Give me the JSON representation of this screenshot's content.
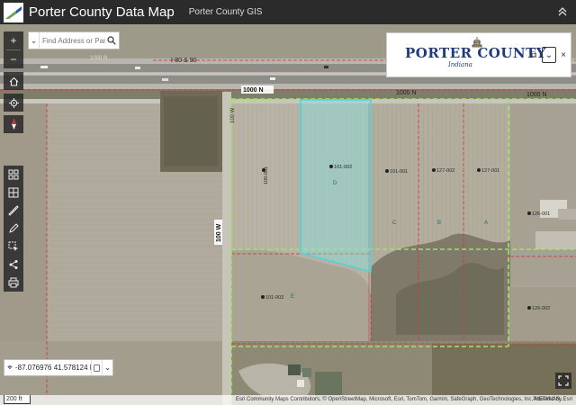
{
  "header": {
    "title": "Porter County Data Map",
    "subtitle": "Porter County GIS",
    "menu_icon": "chevron-up-icon"
  },
  "search": {
    "placeholder": "Find Address or Parc..."
  },
  "toolbar_top": [
    "zoom-in-icon",
    "zoom-out-icon",
    "home-icon",
    "locate-icon",
    "compass-icon"
  ],
  "zoom": {
    "in": "+",
    "out": "−"
  },
  "toolbar_tools": [
    "basemap-icon",
    "layers-icon",
    "measure-icon",
    "draw-icon",
    "select-icon",
    "share-icon",
    "print-icon"
  ],
  "brand": {
    "name": "PORTER COUNTY",
    "tagline": "Indiana",
    "minimize_label": "⧉",
    "dropdown_label": "⌄",
    "close_label": "×"
  },
  "coordinates": {
    "value": "-87.076976 41.578124 Degr..."
  },
  "scale": {
    "label": "200 ft"
  },
  "attribution": "Esri Community Maps Contributors, © OpenStreetMap, Microsoft, Esri, TomTom, Garmin, SafeGraph, GeoTechnologies, Inc, METI/NAS...",
  "powered_by": "Powered by Esri",
  "map_labels": {
    "highway": "I-80 & 90",
    "road_north_1": "1000 N",
    "road_north_2": "1000 N",
    "road_north_3": "1000 N",
    "road_north_4": "1000 N",
    "road_west": "100 W",
    "road_west_2": "100 W",
    "parcels": [
      "101-002",
      "101-001",
      "127-002",
      "127-001",
      "100-001",
      "101-003",
      "126-001",
      "126-002"
    ],
    "parcel_letters": [
      "D",
      "C",
      "B",
      "A",
      "E"
    ]
  },
  "colors": {
    "selection_fill": "#7fe8ea",
    "selection_stroke": "#4fd3d6",
    "parcel_line": "#d23a3a",
    "boundary": "#a6e06b"
  }
}
